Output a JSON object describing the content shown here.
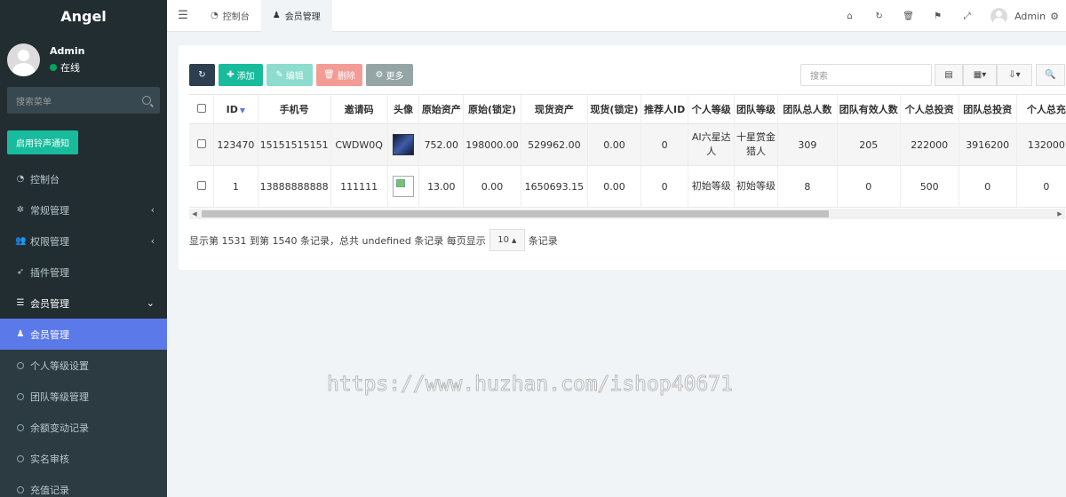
{
  "app": {
    "brand": "Angel"
  },
  "user": {
    "name": "Admin",
    "status": "在线"
  },
  "sidebar": {
    "search_placeholder": "搜索菜单",
    "notice_button": "启用铃声通知",
    "items": [
      {
        "label": "控制台",
        "icon": "dashboard-icon"
      },
      {
        "label": "常规管理",
        "icon": "cogs-icon"
      },
      {
        "label": "权限管理",
        "icon": "users-icon"
      },
      {
        "label": "插件管理",
        "icon": "rocket-icon"
      },
      {
        "label": "会员管理",
        "icon": "list-icon"
      },
      {
        "label": "会员管理",
        "icon": "user-icon"
      },
      {
        "label": "个人等级设置",
        "icon": "circle-icon"
      },
      {
        "label": "团队等级管理",
        "icon": "circle-icon"
      },
      {
        "label": "余额变动记录",
        "icon": "circle-icon"
      },
      {
        "label": "实名审核",
        "icon": "circle-icon"
      },
      {
        "label": "充值记录",
        "icon": "circle-icon"
      }
    ]
  },
  "topbar": {
    "tabs": [
      {
        "label": "控制台",
        "icon": "dashboard-icon"
      },
      {
        "label": "会员管理",
        "icon": "user-icon"
      }
    ],
    "admin_label": "Admin"
  },
  "toolbar": {
    "add": "添加",
    "edit": "编辑",
    "delete": "删除",
    "more": "更多",
    "search_placeholder": "搜索",
    "page_size": "10"
  },
  "table": {
    "headers": [
      "ID",
      "手机号",
      "邀请码",
      "头像",
      "原始资产",
      "原始(锁定)",
      "现货资产",
      "现货(锁定)",
      "推荐人ID",
      "个人等级",
      "团队等级",
      "团队总人数",
      "团队有效人数",
      "个人总投资",
      "团队总投资",
      "个人总充"
    ],
    "rows": [
      {
        "id": "123470",
        "phone": "15151515151",
        "code": "CWDW0Q",
        "orig": "752.00",
        "orig_lock": "198000.00",
        "spot": "529962.00",
        "spot_lock": "0.00",
        "ref": "0",
        "level": "AI六星达人",
        "team_level": "十星赏金猎人",
        "team_total": "309",
        "team_valid": "205",
        "invest": "222000",
        "team_invest": "3916200",
        "recharge": "132000"
      },
      {
        "id": "1",
        "phone": "13888888888",
        "code": "111111",
        "orig": "13.00",
        "orig_lock": "0.00",
        "spot": "1650693.15",
        "spot_lock": "0.00",
        "ref": "0",
        "level": "初始等级",
        "team_level": "初始等级",
        "team_total": "8",
        "team_valid": "0",
        "invest": "500",
        "team_invest": "0",
        "recharge": "0"
      }
    ]
  },
  "pagination": {
    "prefix": "显示第 1531 到第 1540 条记录，总共 undefined 条记录 每页显示",
    "suffix": "条记录"
  },
  "watermark": "https://www.huzhan.com/ishop40671"
}
